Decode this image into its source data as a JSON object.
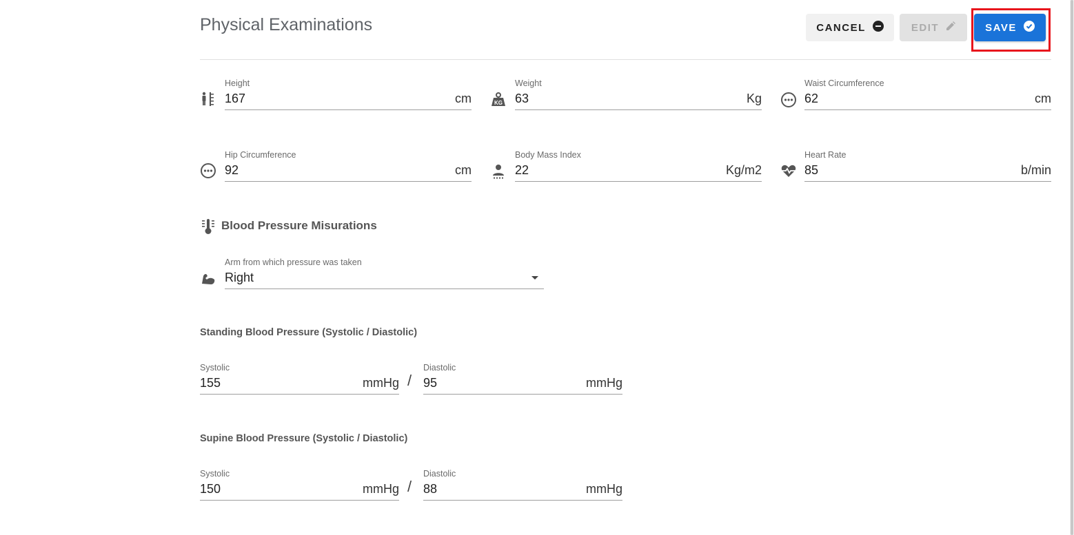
{
  "page": {
    "title": "Physical Examinations"
  },
  "actions": {
    "cancel_label": "CANCEL",
    "edit_label": "EDIT",
    "save_label": "SAVE"
  },
  "measurements": {
    "height": {
      "label": "Height",
      "value": "167",
      "unit": "cm",
      "icon": "height-icon"
    },
    "weight": {
      "label": "Weight",
      "value": "63",
      "unit": "Kg",
      "icon": "weight-kg-icon"
    },
    "waist": {
      "label": "Waist Circumference",
      "value": "62",
      "unit": "cm",
      "icon": "more-circle-icon"
    },
    "hip": {
      "label": "Hip Circumference",
      "value": "92",
      "unit": "cm",
      "icon": "more-circle-icon"
    },
    "bmi": {
      "label": "Body Mass Index",
      "value": "22",
      "unit": "Kg/m2",
      "icon": "person-icon"
    },
    "heart_rate": {
      "label": "Heart Rate",
      "value": "85",
      "unit": "b/min",
      "icon": "heart-pulse-icon"
    }
  },
  "blood_pressure": {
    "section_title": "Blood Pressure Misurations",
    "arm": {
      "label": "Arm from which pressure was taken",
      "value": "Right"
    },
    "standing": {
      "heading": "Standing Blood Pressure (Systolic / Diastolic)",
      "systolic": {
        "label": "Systolic",
        "value": "155",
        "unit": "mmHg"
      },
      "separator": "/",
      "diastolic": {
        "label": "Diastolic",
        "value": "95",
        "unit": "mmHg"
      }
    },
    "supine": {
      "heading": "Supine Blood Pressure (Systolic / Diastolic)",
      "systolic": {
        "label": "Systolic",
        "value": "150",
        "unit": "mmHg"
      },
      "separator": "/",
      "diastolic": {
        "label": "Diastolic",
        "value": "88",
        "unit": "mmHg"
      }
    }
  },
  "colors": {
    "primary": "#1a73d9",
    "highlight": "#e8151c",
    "text": "#333333",
    "muted": "#6a6a6a"
  }
}
